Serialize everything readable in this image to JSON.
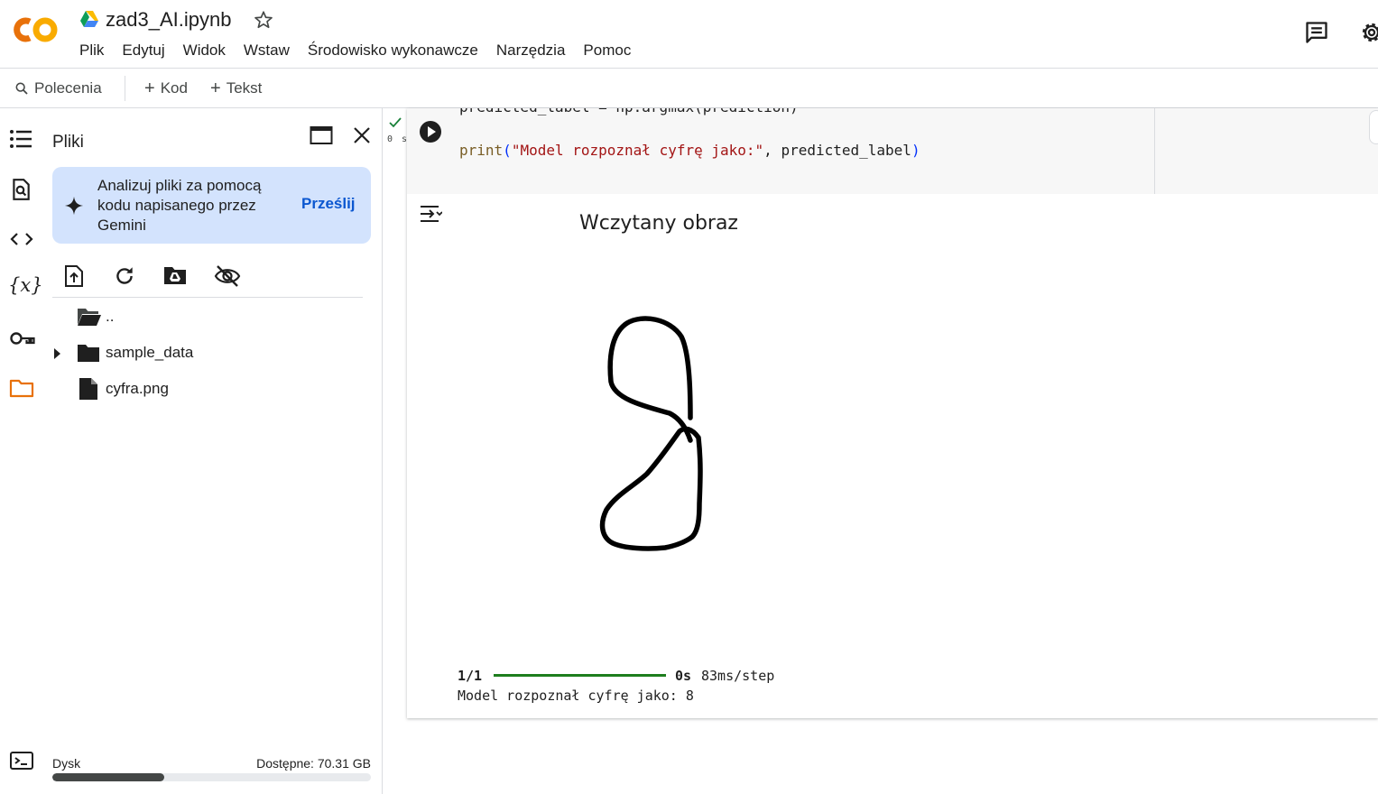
{
  "header": {
    "logo_text": "CO",
    "notebook_title": "zad3_AI.ipynb",
    "menu": [
      "Plik",
      "Edytuj",
      "Widok",
      "Wstaw",
      "Środowisko wykonawcze",
      "Narzędzia",
      "Pomoc"
    ],
    "icons": [
      "colab-logo",
      "google-drive-icon",
      "star-icon",
      "comment-icon",
      "gear-icon"
    ]
  },
  "toolbar": {
    "commands_label": "Polecenia",
    "add_code_label": "Kod",
    "add_text_label": "Tekst"
  },
  "rail": {
    "icons": [
      "table-of-contents-icon",
      "find-replace-icon",
      "code-snippets-icon",
      "variables-icon",
      "secrets-key-icon",
      "files-folder-icon",
      "terminal-icon"
    ],
    "variables_glyph": "{x}"
  },
  "files_panel": {
    "title": "Pliki",
    "gemini_card": {
      "text": "Analizuj pliki za pomocą kodu napisanego przez Gemini",
      "action": "Prześlij"
    },
    "tools": [
      "upload-file-icon",
      "refresh-icon",
      "mount-drive-icon",
      "hide-files-icon"
    ],
    "entries": [
      {
        "name": "..",
        "kind": "parent-folder"
      },
      {
        "name": "sample_data",
        "kind": "folder",
        "expandable": true
      },
      {
        "name": "cyfra.png",
        "kind": "file"
      }
    ],
    "disk": {
      "label": "Dysk",
      "available": "Dostępne: 70.31 GB",
      "used_fraction": 0.35
    }
  },
  "cell": {
    "status": "0 s",
    "code_lines": {
      "line1": "predicted_label = np.argmax(prediction)",
      "line2_fn": "print",
      "line2_open": "(",
      "line2_str": "\"Model rozpoznał cyfrę jako:\"",
      "line2_arg": ", predicted_label",
      "line2_close": ")"
    },
    "output": {
      "plot_title": "Wczytany obraz",
      "image_file": "cyfra.png",
      "progress_step": "1/1",
      "progress_time": "0s",
      "progress_rate": "83ms/step",
      "result_text": "Model rozpoznał cyfrę jako: 8"
    }
  },
  "colors": {
    "accent_blue": "#0b57d0",
    "gemini_card_bg": "#d3e3fd",
    "logo_orange": "#f9ab00",
    "logo_deep_orange": "#e8710a",
    "files_active": "#e8710a",
    "progress_green": "#1e7e1e",
    "check_green": "#188038"
  }
}
